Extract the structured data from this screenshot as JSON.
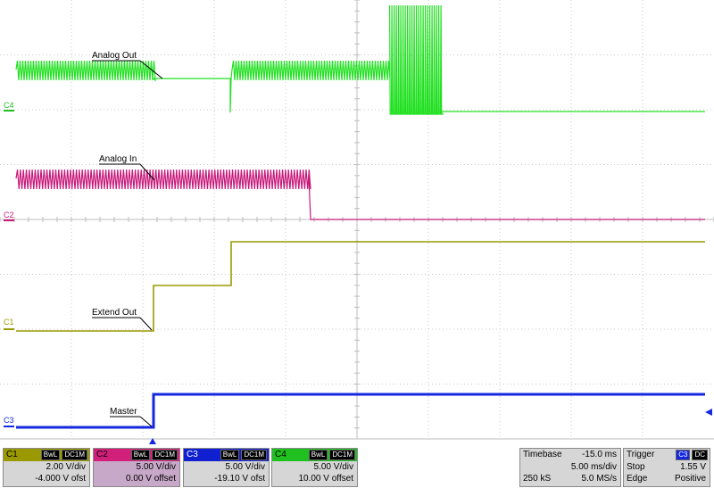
{
  "grid": {
    "cols": 10,
    "rows": 8
  },
  "annotations": {
    "analog_out": "Analog Out",
    "analog_in": "Analog In",
    "extend_out": "Extend Out",
    "master": "Master"
  },
  "channel_markers": {
    "c4": "C4",
    "c2": "C2",
    "c1": "C1",
    "c3": "C3"
  },
  "colors": {
    "c1": "#9a9a00",
    "c2": "#e0187a",
    "c3": "#1428e0",
    "c4": "#22e022"
  },
  "channels": [
    {
      "name": "C1",
      "bwl": "BwL",
      "coupling": "DC1M",
      "vdiv": "2.00 V/div",
      "offset": "-4.000 V ofst"
    },
    {
      "name": "C2",
      "bwl": "BwL",
      "coupling": "DC1M",
      "vdiv": "5.00 V/div",
      "offset": "0.00 V offset"
    },
    {
      "name": "C3",
      "bwl": "BwL",
      "coupling": "DC1M",
      "vdiv": "5.00 V/div",
      "offset": "-19.10 V ofst"
    },
    {
      "name": "C4",
      "bwl": "BwL",
      "coupling": "DC1M",
      "vdiv": "5.00 V/div",
      "offset": "10.00 V offset"
    }
  ],
  "timebase": {
    "label": "Timebase",
    "delay": "-15.0 ms",
    "tdiv": "5.00 ms/div",
    "samples": "250 kS",
    "rate": "5.0 MS/s"
  },
  "trigger": {
    "label": "Trigger",
    "channel": "C3",
    "coupling": "DC",
    "mode": "Stop",
    "level": "1.55 V",
    "type": "Edge",
    "slope": "Positive"
  }
}
